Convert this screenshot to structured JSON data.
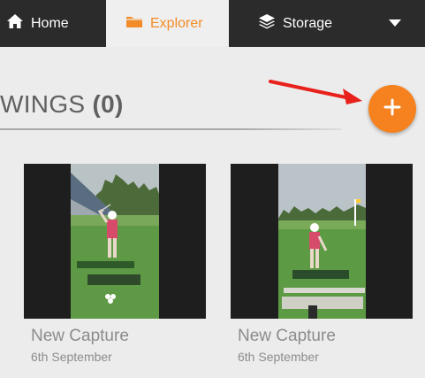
{
  "nav": {
    "tabs": [
      {
        "label": "Home",
        "icon": "home-icon"
      },
      {
        "label": "Explorer",
        "icon": "folder-icon"
      },
      {
        "label": "Storage",
        "icon": "layers-icon"
      }
    ],
    "active_tab": "Explorer",
    "dropdown_icon": "caret-down-icon"
  },
  "section": {
    "title_word": "WINGS",
    "count": "(0)"
  },
  "add_button": {
    "icon": "plus-icon",
    "color": "#f5821f"
  },
  "annotation": {
    "arrow_color": "#e8211c"
  },
  "captures": [
    {
      "title": "New Capture",
      "date": "6th September"
    },
    {
      "title": "New Capture",
      "date": "6th September"
    }
  ],
  "colors": {
    "nav_bg": "#2b2b2b",
    "accent": "#f28c28"
  }
}
